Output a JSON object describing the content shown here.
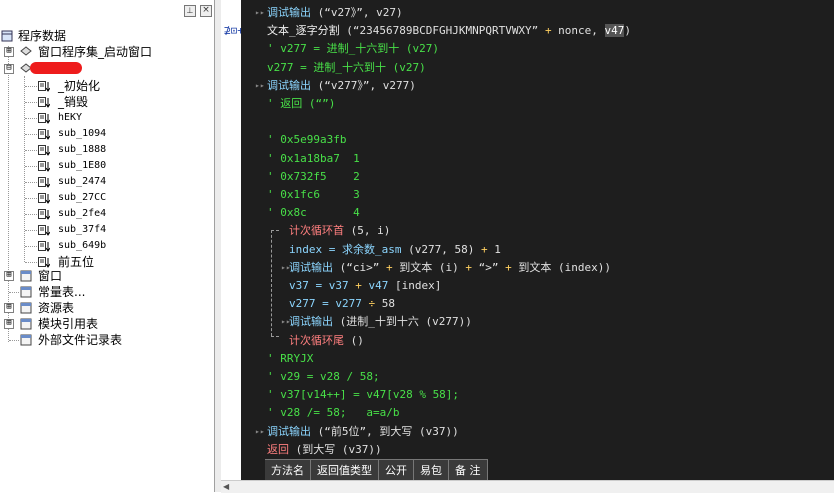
{
  "tree": {
    "root": "程序数据",
    "items": [
      {
        "label": "窗口程序集_启动窗口",
        "expander": "⊞"
      },
      {
        "label": "",
        "expander": "⊟"
      }
    ],
    "subs": [
      "_初始化",
      "_销毁",
      "hEKY",
      "sub_1094",
      "sub_1888",
      "sub_1E80",
      "sub_2474",
      "sub_27CC",
      "sub_2fe4",
      "sub_37f4",
      "sub_649b",
      "前五位"
    ],
    "bottom": [
      {
        "label": "窗口",
        "expander": "⊞"
      },
      {
        "label": "常量表...",
        "expander": ""
      },
      {
        "label": "资源表",
        "expander": "⊞"
      },
      {
        "label": "模块引用表",
        "expander": "⊞"
      },
      {
        "label": "外部文件记录表",
        "expander": ""
      }
    ],
    "pin_glyph": "⊥",
    "close_glyph": "×"
  },
  "code": [
    {
      "parts": [
        [
          "fn",
          "调试输出"
        ],
        [
          "str",
          " (“v27》”, v27)"
        ]
      ]
    },
    {
      "parts": [
        [
          "cn",
          "文本_逐字分割 "
        ],
        [
          "str",
          "(“23456789BCDFGHJKMNPQRTVWXY” "
        ],
        [
          "yel",
          "+"
        ],
        [
          "str",
          " nonce, "
        ],
        [
          "hl",
          "v47"
        ],
        [
          "str",
          ")"
        ]
      ]
    },
    {
      "parts": [
        [
          "cmt",
          "' v277 = 进制_十六到十 (v27)"
        ]
      ]
    },
    {
      "parts": [
        [
          "grn",
          "v277 = 进制_十六到十 (v27)"
        ]
      ]
    },
    {
      "parts": [
        [
          "fn",
          "调试输出"
        ],
        [
          "str",
          " (“v277》”, v277)"
        ]
      ]
    },
    {
      "parts": [
        [
          "cmt",
          "' 返回 (“”)"
        ]
      ]
    },
    {
      "parts": [
        [
          "str",
          ""
        ]
      ]
    },
    {
      "parts": [
        [
          "cmt",
          "' 0x5e99a3fb"
        ]
      ]
    },
    {
      "parts": [
        [
          "cmt",
          "' 0x1a18ba7  1"
        ]
      ]
    },
    {
      "parts": [
        [
          "cmt",
          "' 0x732f5    2"
        ]
      ]
    },
    {
      "parts": [
        [
          "cmt",
          "' 0x1fc6     3"
        ]
      ]
    },
    {
      "parts": [
        [
          "cmt",
          "' 0x8c       4"
        ]
      ]
    },
    {
      "parts": [
        [
          "kwn",
          "计次循环首"
        ],
        [
          "str",
          " (5, i)"
        ]
      ]
    },
    {
      "parts": [
        [
          "fn",
          "index = 求余数_asm "
        ],
        [
          "str",
          "(v277, 58) "
        ],
        [
          "yel",
          "+"
        ],
        [
          "str",
          " 1"
        ]
      ]
    },
    {
      "parts": [
        [
          "fn",
          "调试输出"
        ],
        [
          "str",
          " (“ci>” "
        ],
        [
          "yel",
          "+"
        ],
        [
          "str",
          " 到文本 (i) "
        ],
        [
          "yel",
          "+"
        ],
        [
          "str",
          " “>” "
        ],
        [
          "yel",
          "+"
        ],
        [
          "str",
          " 到文本 (index))"
        ]
      ]
    },
    {
      "parts": [
        [
          "var",
          "v37 = v37 "
        ],
        [
          "yel",
          "+"
        ],
        [
          "var",
          " v47 "
        ],
        [
          "str",
          "[index]"
        ]
      ]
    },
    {
      "parts": [
        [
          "var",
          "v277 = v277 "
        ],
        [
          "yel",
          "÷"
        ],
        [
          "str",
          " 58"
        ]
      ]
    },
    {
      "parts": [
        [
          "fn",
          "调试输出"
        ],
        [
          "str",
          " (进制_十到十六 (v277))"
        ]
      ]
    },
    {
      "parts": [
        [
          "kwn",
          "计次循环尾"
        ],
        [
          "str",
          " ()"
        ]
      ]
    },
    {
      "parts": [
        [
          "cmt",
          "' RRYJX"
        ]
      ]
    },
    {
      "parts": [
        [
          "cmt",
          "' v29 = v28 / 58;"
        ]
      ]
    },
    {
      "parts": [
        [
          "cmt",
          "' v37[v14++] = v47[v28 % 58];"
        ]
      ]
    },
    {
      "parts": [
        [
          "cmt",
          "' v28 /= 58;   a=a/b"
        ]
      ]
    },
    {
      "parts": [
        [
          "fn",
          "调试输出"
        ],
        [
          "str",
          " (“前5位”, 到大写 (v37))"
        ]
      ]
    },
    {
      "parts": [
        [
          "kwn",
          "返回"
        ],
        [
          "str",
          " (到大写 (v37))"
        ]
      ]
    }
  ],
  "table_headers": [
    "方法名",
    "返回值类型",
    "公开",
    "易包",
    "备 注"
  ],
  "gutter_marker": "⊉⊡+",
  "colors": {
    "editor_bg": "#1e1e1e",
    "comment": "#48e048",
    "keyword": "#ff7f7f",
    "function": "#8cd6ff",
    "operator": "#ffd060"
  }
}
